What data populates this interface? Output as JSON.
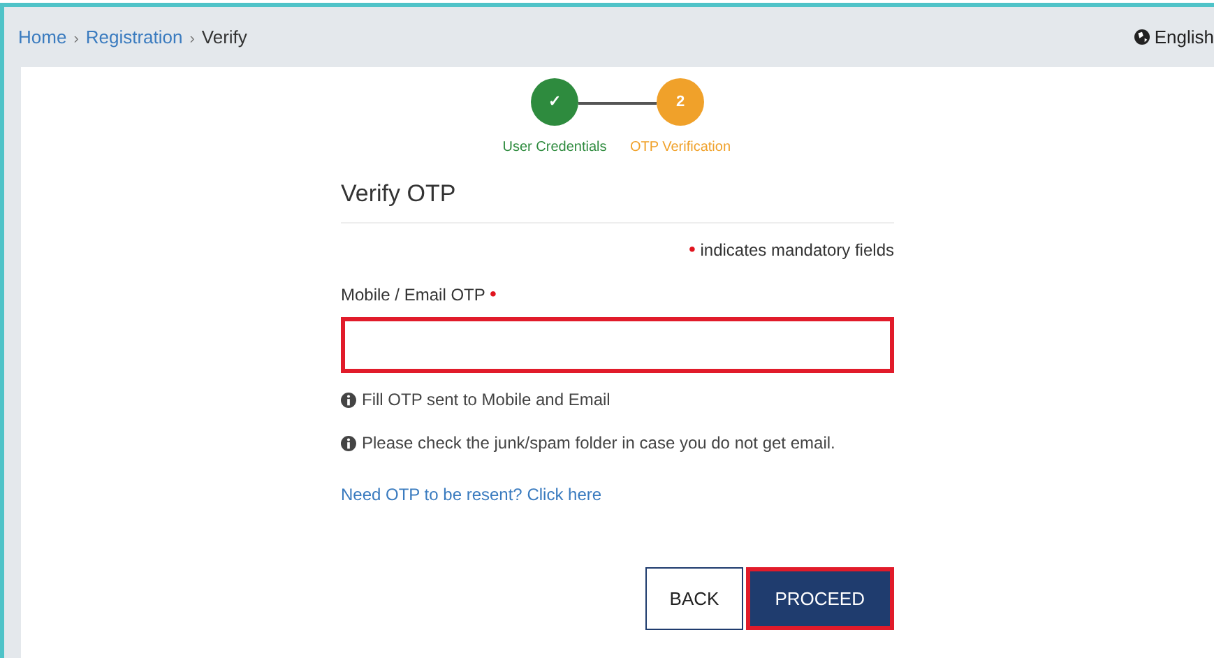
{
  "breadcrumb": [
    {
      "label": "Home",
      "current": false
    },
    {
      "label": "Registration",
      "current": false
    },
    {
      "label": "Verify",
      "current": true
    }
  ],
  "breadcrumb_separator": "›",
  "language": {
    "label": "English"
  },
  "steps": [
    {
      "label": "User Credentials",
      "completed": true,
      "marker": "✓"
    },
    {
      "label": "OTP Verification",
      "completed": false,
      "marker": "2"
    }
  ],
  "form": {
    "title": "Verify OTP",
    "mandatory_note": "indicates mandatory fields",
    "required_mark": "•",
    "field": {
      "label": "Mobile / Email OTP",
      "required": true,
      "highlighted": true
    },
    "hints": [
      "Fill OTP sent to Mobile and Email",
      "Please check the junk/spam folder in case you do not get email."
    ],
    "resend_link": "Need OTP to be resent? Click here"
  },
  "buttons": [
    {
      "label": "BACK",
      "kind": "secondary",
      "highlighted": false
    },
    {
      "label": "PROCEED",
      "kind": "primary",
      "highlighted": true
    }
  ]
}
